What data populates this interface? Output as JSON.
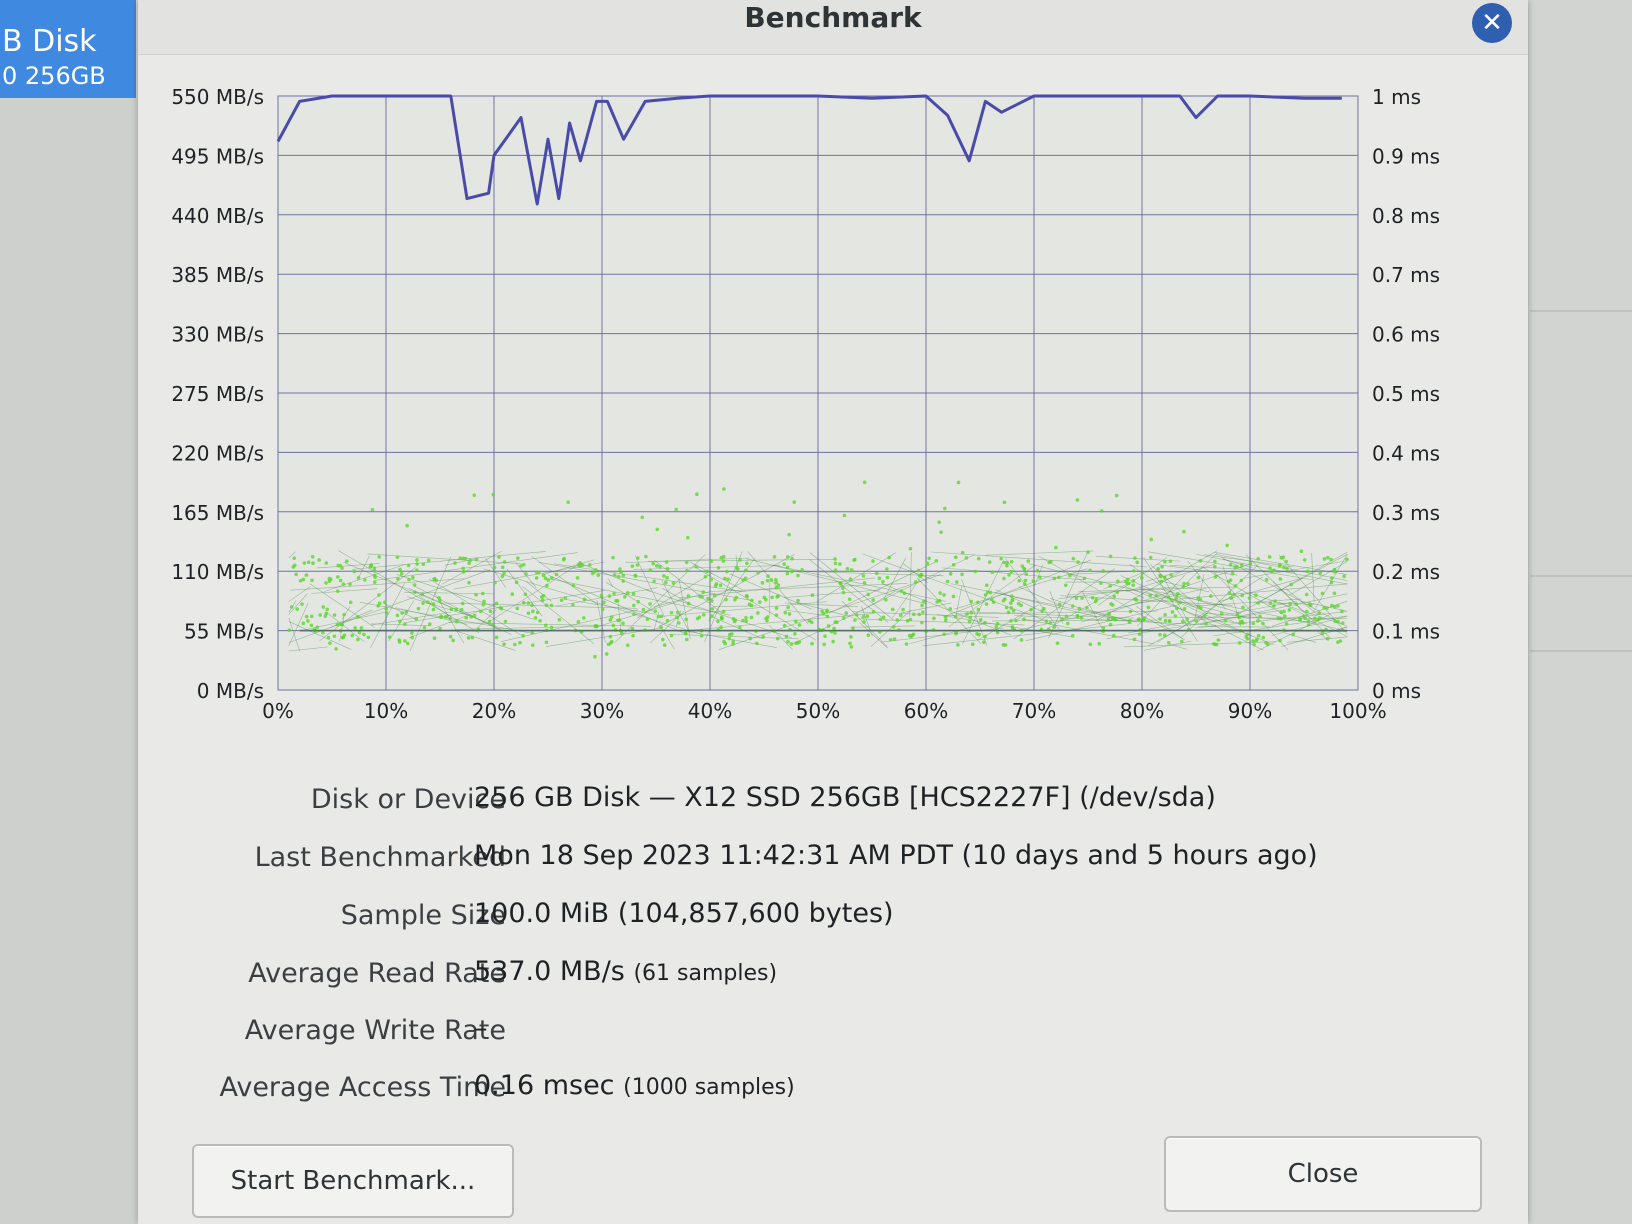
{
  "sidebar": {
    "selected_item": {
      "name": "B Disk",
      "size": "0 256GB"
    }
  },
  "dialog": {
    "title": "Benchmark",
    "close_icon": "close-icon"
  },
  "chart_data": {
    "type": "line",
    "x_axis": {
      "ticks": [
        "0%",
        "10%",
        "20%",
        "30%",
        "40%",
        "50%",
        "60%",
        "70%",
        "80%",
        "90%",
        "100%"
      ],
      "range": [
        0,
        100
      ]
    },
    "y_left_axis": {
      "ticks": [
        "0 MB/s",
        "55 MB/s",
        "110 MB/s",
        "165 MB/s",
        "220 MB/s",
        "275 MB/s",
        "330 MB/s",
        "385 MB/s",
        "440 MB/s",
        "495 MB/s",
        "550 MB/s"
      ],
      "range": [
        0,
        550
      ],
      "unit": "MB/s"
    },
    "y_right_axis": {
      "ticks": [
        "0 ms",
        "0.1 ms",
        "0.2 ms",
        "0.3 ms",
        "0.4 ms",
        "0.5 ms",
        "0.6 ms",
        "0.7 ms",
        "0.8 ms",
        "0.9 ms",
        "1 ms"
      ],
      "range": [
        0,
        1
      ],
      "unit": "ms"
    },
    "grid": true,
    "series": [
      {
        "color": "#4a4aa8",
        "axis": "left",
        "x": [
          0,
          2,
          5,
          10,
          16,
          17.5,
          19.5,
          20,
          22.5,
          24,
          25,
          26,
          27,
          28,
          29.5,
          30.5,
          32,
          34,
          37,
          40,
          45,
          50,
          55,
          60,
          62,
          64,
          65.5,
          67,
          70,
          75,
          80,
          83.5,
          85,
          87,
          90,
          95,
          98.5
        ],
        "y": [
          508,
          545,
          550,
          550,
          550,
          455,
          460,
          495,
          530,
          450,
          510,
          455,
          525,
          490,
          545,
          545,
          510,
          545,
          548,
          550,
          550,
          550,
          548,
          550,
          532,
          490,
          545,
          535,
          550,
          550,
          550,
          550,
          530,
          550,
          550,
          548,
          548
        ]
      },
      {
        "color": "#5cd62e",
        "axis": "right",
        "style": "scatter-cloud",
        "bands_ms": [
          0.1,
          0.14,
          0.2
        ],
        "mean_ms": 0.16
      }
    ]
  },
  "info": {
    "device_label": "Disk or Device",
    "device_value": "256 GB Disk — X12 SSD 256GB [HCS2227F] (/dev/sda)",
    "last_label": "Last Benchmarked",
    "last_value": "Mon 18 Sep 2023 11:42:31 AM PDT (10 days and 5 hours ago)",
    "sample_label": "Sample Size",
    "sample_value": "100.0 MiB (104,857,600 bytes)",
    "read_label": "Average Read Rate",
    "read_value": "537.0 MB/s",
    "read_samples": "(61 samples)",
    "write_label": "Average Write Rate",
    "write_value": "–",
    "access_label": "Average Access Time",
    "access_value": "0.16 msec",
    "access_samples": "(1000 samples)"
  },
  "buttons": {
    "start_label": "Start Benchmark...",
    "close_label": "Close"
  }
}
